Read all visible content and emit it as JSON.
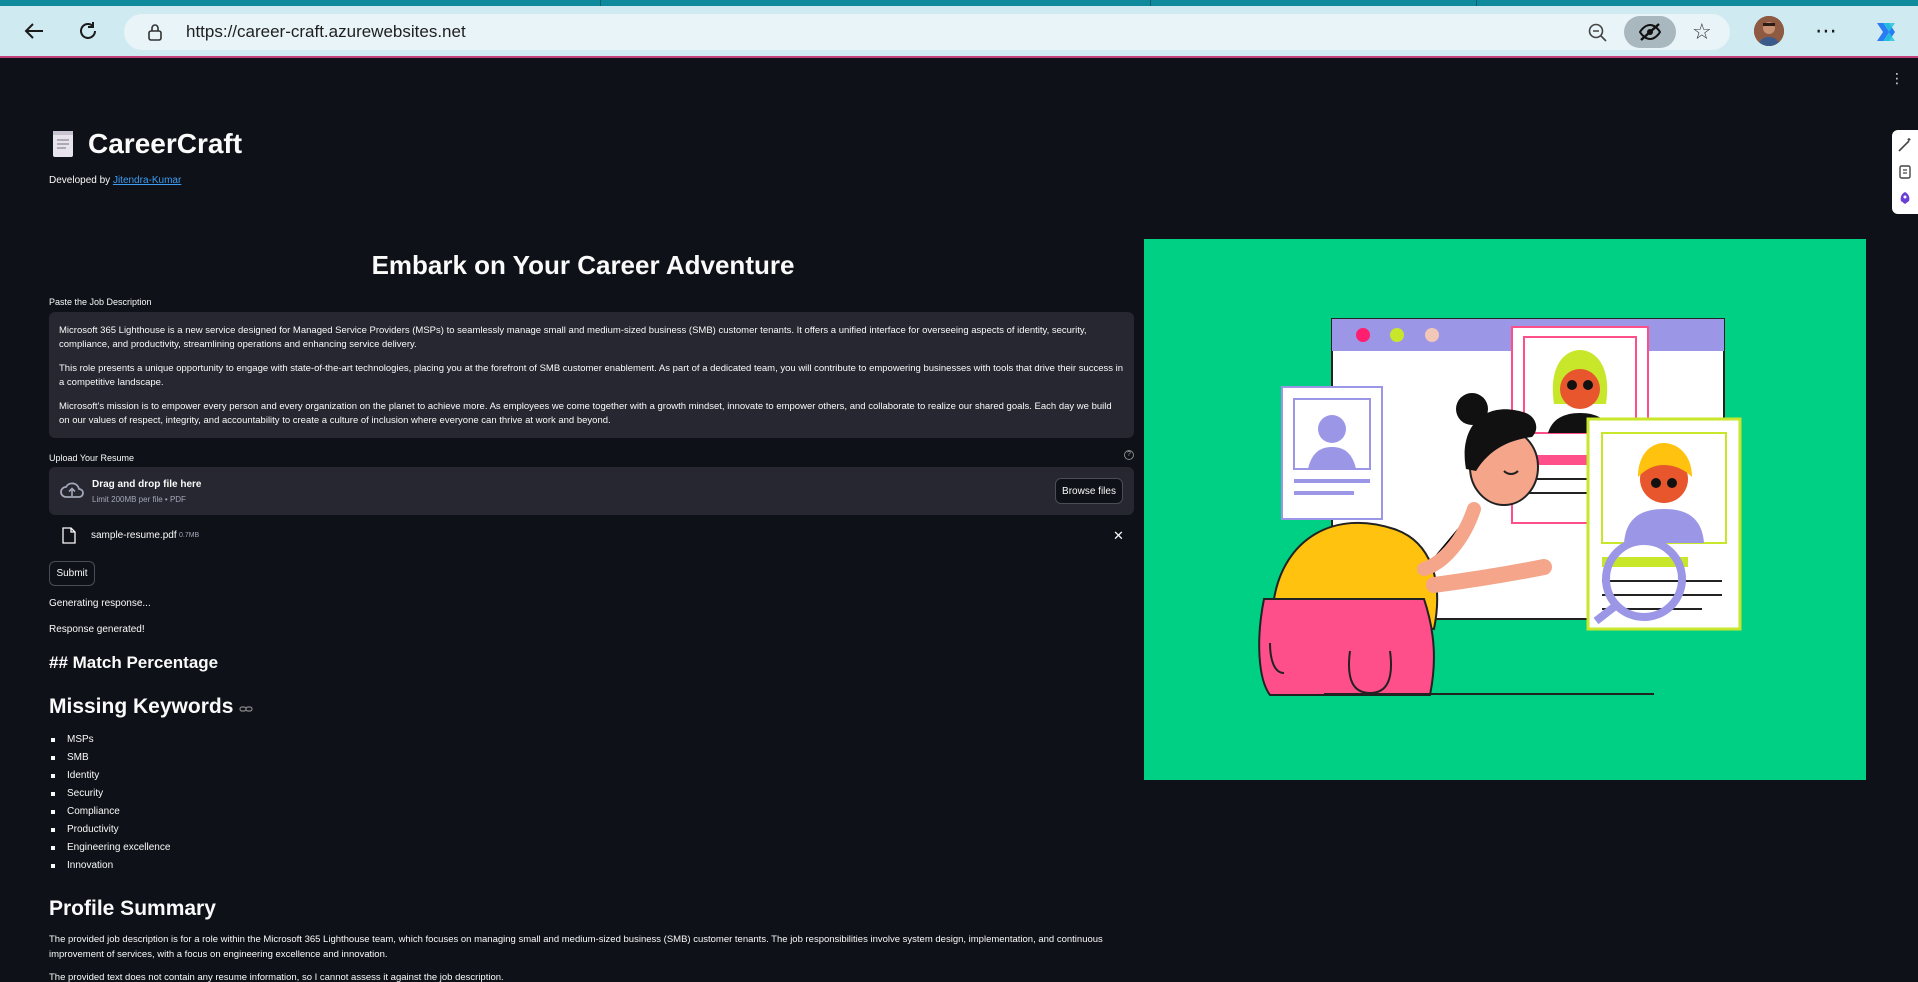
{
  "browser": {
    "url": "https://career-craft.azurewebsites.net",
    "icons": [
      "back-icon",
      "refresh-icon",
      "lock-icon",
      "zoom-out-icon",
      "eye-off-icon",
      "star-icon",
      "profile-avatar",
      "more-icon",
      "copilot-icon"
    ]
  },
  "app": {
    "title": "CareerCraft",
    "developed_by": "Developed by ",
    "author": "Jitendra-Kumar"
  },
  "form": {
    "heading": "Embark on Your Career Adventure",
    "jd_label": "Paste the Job Description",
    "jd_paragraphs": [
      "Microsoft 365 Lighthouse is a new service designed for Managed Service Providers (MSPs) to seamlessly manage small and medium-sized business (SMB) customer tenants. It offers a unified interface for overseeing aspects of identity, security, compliance, and productivity, streamlining operations and enhancing service delivery.",
      "This role presents a unique opportunity to engage with state-of-the-art technologies, placing you at the forefront of SMB customer enablement. As part of a dedicated team, you will contribute to empowering businesses with tools that drive their success in a competitive landscape.",
      "Microsoft's mission is to empower every person and every organization on the planet to achieve more. As employees we come together with a growth mindset, innovate to empower others, and collaborate to realize our shared goals. Each day we build on our values of respect, integrity, and accountability to create a culture of inclusion where everyone can thrive at work and beyond."
    ],
    "upload_label": "Upload Your Resume",
    "drop_text": "Drag and drop file here",
    "drop_limit": "Limit 200MB per file • PDF",
    "browse_label": "Browse files",
    "file_name": "sample-resume.pdf",
    "file_size": "0.7MB",
    "submit_label": "Submit"
  },
  "status": {
    "generating": "Generating response...",
    "done": "Response generated!"
  },
  "results": {
    "match_heading": "## Match Percentage",
    "missing_heading": "Missing Keywords",
    "keywords": [
      "MSPs",
      "SMB",
      "Identity",
      "Security",
      "Compliance",
      "Productivity",
      "Engineering excellence",
      "Innovation"
    ],
    "profile_heading": "Profile Summary",
    "profile_paragraphs": [
      "The provided job description is for a role within the Microsoft 365 Lighthouse team, which focuses on managing small and medium-sized business (SMB) customer tenants. The job responsibilities involve system design, implementation, and continuous improvement of services, with a focus on engineering excellence and innovation.",
      "The provided text does not contain any resume information, so I cannot assess it against the job description."
    ]
  },
  "colors": {
    "page_bg": "#0e1117",
    "input_bg": "#262730",
    "link": "#3d9df3",
    "hero_bg": "#00d084"
  }
}
